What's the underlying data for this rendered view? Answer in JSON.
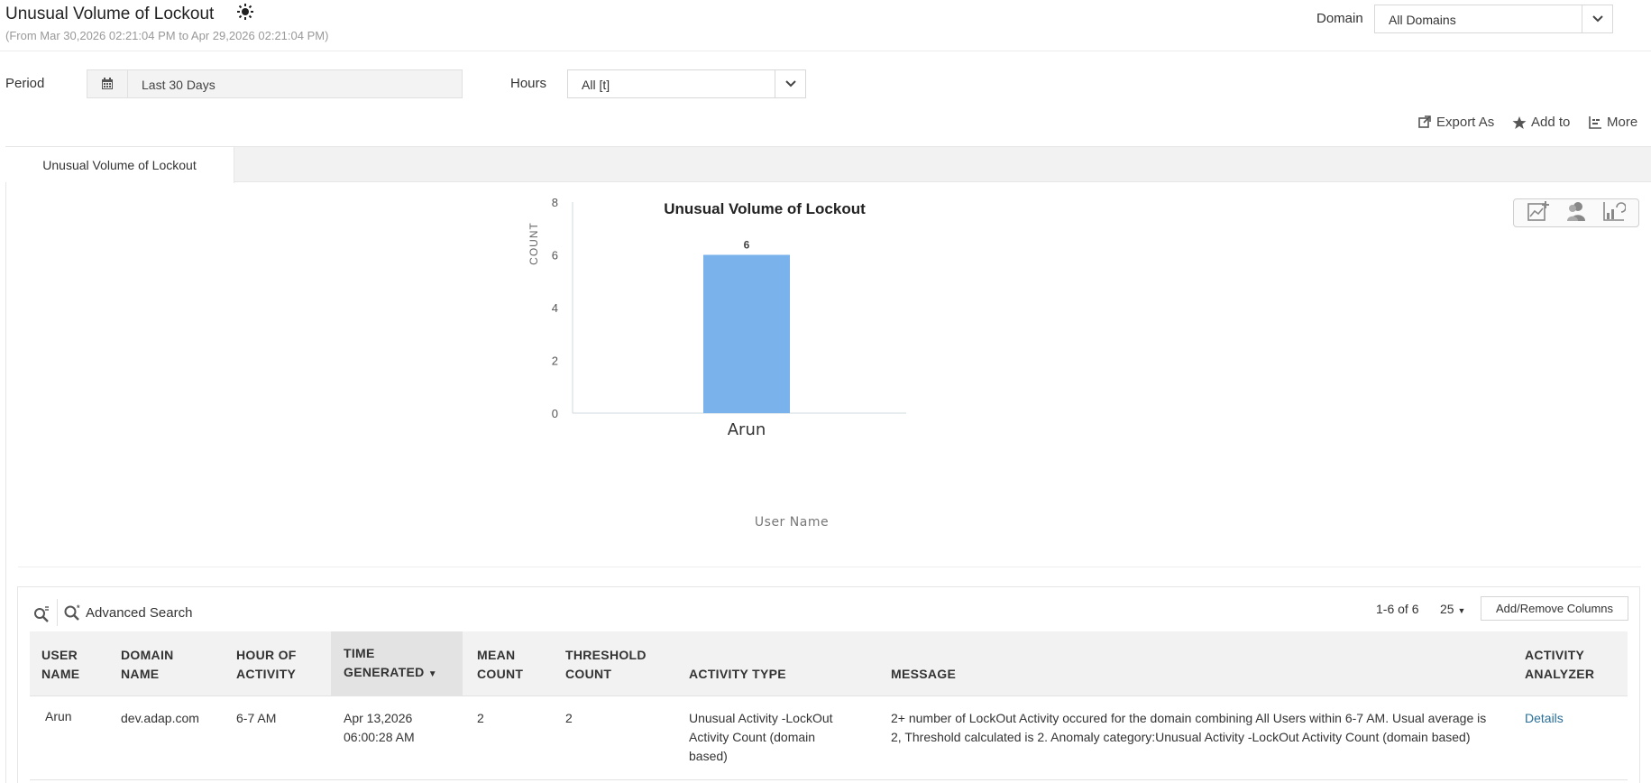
{
  "header": {
    "title": "Unusual Volume of Lockout",
    "date_range": "(From Mar 30,2026 02:21:04 PM to Apr 29,2026 02:21:04 PM)",
    "domain_label": "Domain",
    "domain_value": "All Domains"
  },
  "filters": {
    "period_label": "Period",
    "period_value": "Last 30 Days",
    "hours_label": "Hours",
    "hours_value": "All [t]"
  },
  "toolbar": {
    "export_label": "Export As",
    "add_label": "Add to",
    "more_label": "More"
  },
  "tabs": [
    {
      "label": "Unusual Volume of Lockout"
    }
  ],
  "chart_data": {
    "type": "bar",
    "title": "Unusual Volume of Lockout",
    "categories": [
      "Arun"
    ],
    "values": [
      6
    ],
    "data_labels": [
      "6"
    ],
    "xlabel": "User Name",
    "ylabel": "COUNT",
    "ylim": [
      0,
      8
    ],
    "yticks": [
      0,
      2,
      4,
      6,
      8
    ],
    "grid": false,
    "bar_color": "#7ab3ec"
  },
  "grid": {
    "advanced_search_label": "Advanced Search",
    "page_info": "1-6 of 6",
    "page_size": "25",
    "add_remove_columns_label": "Add/Remove Columns",
    "columns": [
      {
        "line1": "USER",
        "line2": "NAME"
      },
      {
        "line1": "DOMAIN",
        "line2": "NAME"
      },
      {
        "line1": "HOUR OF",
        "line2": "ACTIVITY"
      },
      {
        "line1": "TIME",
        "line2": "GENERATED"
      },
      {
        "line1": "MEAN",
        "line2": "COUNT"
      },
      {
        "line1": "THRESHOLD",
        "line2": "COUNT"
      },
      {
        "line1": "",
        "line2": "ACTIVITY TYPE"
      },
      {
        "line1": "",
        "line2": "MESSAGE"
      },
      {
        "line1": "ACTIVITY",
        "line2": "ANALYZER"
      }
    ],
    "rows": [
      {
        "user_name": "Arun",
        "domain_name": "dev.adap.com",
        "hour_of_activity": "6-7 AM",
        "time_generated_date": "Apr 13,2026",
        "time_generated_time": "06:00:28 AM",
        "mean_count": "2",
        "threshold_count": "2",
        "activity_type": "Unusual Activity -LockOut Activity Count (domain based)",
        "message": "2+ number of LockOut Activity occured for the domain combining All Users within 6-7 AM. Usual average is 2, Threshold calculated is 2. Anomaly category:Unusual Activity -LockOut Activity Count (domain based)",
        "analyzer_link": "Details"
      }
    ]
  }
}
